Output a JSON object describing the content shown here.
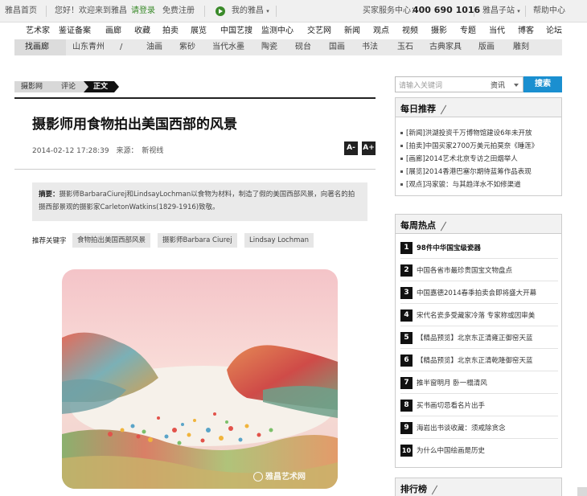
{
  "topbar": {
    "home": "雅昌首页",
    "welcome": "您好！欢迎来到雅昌",
    "login": "请登录",
    "register": "免费注册",
    "my_artron": "我的雅昌",
    "service_label": "买家服务中心：",
    "service_phone": "400 690 1016",
    "sub_sites": "雅昌子站",
    "help": "帮助中心"
  },
  "nav": {
    "main": [
      "艺术家",
      "鉴证备案",
      "画廊",
      "收藏",
      "拍卖",
      "展览",
      "中国艺搜",
      "监测中心",
      "交艺网",
      "新闻",
      "观点",
      "视频",
      "摄影",
      "专题",
      "当代",
      "博客",
      "论坛"
    ],
    "sub_first": "找画廊",
    "sub": [
      "山东青州",
      "/",
      "油画",
      "紫砂",
      "当代水墨",
      "陶瓷",
      "砚台",
      "国画",
      "书法",
      "玉石",
      "古典家具",
      "版画",
      "雕刻"
    ]
  },
  "breadcrumb": [
    "摄影网",
    "评论",
    "正文"
  ],
  "article": {
    "title": "摄影师用食物拍出美国西部的风景",
    "date": "2014-02-12 17:28:39",
    "source_label": "来源：",
    "source": "新视线",
    "font_small": "A-",
    "font_large": "A+",
    "summary_label": "摘要：",
    "summary": "摄影师BarbaraCiurej和LindsayLochman以食物为材料，制造了假的美国西部风景，向著名的拍摄西部景观的摄影家CarletonWatkins(1829-1916)致敬。",
    "keywords_label": "推荐关键字",
    "keywords": [
      "食物拍出美国西部风景",
      "摄影师Barbara Ciurej",
      "Lindsay Lochman"
    ],
    "watermark": "雅昌艺术网"
  },
  "search": {
    "placeholder": "请输入关键词",
    "type": "资讯",
    "button": "搜索"
  },
  "daily": {
    "title": "每日推荐",
    "items": [
      "[新闻]洪湖投资千万博物馆建设6年未开放",
      "[拍卖]中国买家2700万美元拍莫奈《睡莲》",
      "[画廊]2014艺术北京专访之田烟举人",
      "[展览]2014香港巴塞尔期待蓝筹作品表现",
      "[观点]冯家骏：与其趋洋水不如修渠道"
    ]
  },
  "weekly": {
    "title": "每周热点",
    "items": [
      {
        "num": "1",
        "text": "98件中华国宝级瓷器",
        "bold": true
      },
      {
        "num": "2",
        "text": "中国各省市最珍贵国宝文物盘点"
      },
      {
        "num": "3",
        "text": "中国嘉德2014春季拍卖会即将盛大开幕"
      },
      {
        "num": "4",
        "text": "宋代名瓷多受藏家冷落 专家称或因审美"
      },
      {
        "num": "5",
        "text": "【精品预览】北京东正清雍正御窑天蓝"
      },
      {
        "num": "6",
        "text": "【精品预览】北京东正清乾隆御窑天蓝"
      },
      {
        "num": "7",
        "text": "推半窗明月 卧一榻清风"
      },
      {
        "num": "8",
        "text": "买书画切忌看名片出手"
      },
      {
        "num": "9",
        "text": "海岩出书谈收藏：须戒除贪念"
      },
      {
        "num": "10",
        "text": "为什么中国绘画是历史"
      }
    ]
  },
  "ranking": {
    "title": "排行榜"
  },
  "colors": {
    "accent_blue": "#1a8fd0",
    "green": "#3a8a2a",
    "dark": "#111111"
  }
}
